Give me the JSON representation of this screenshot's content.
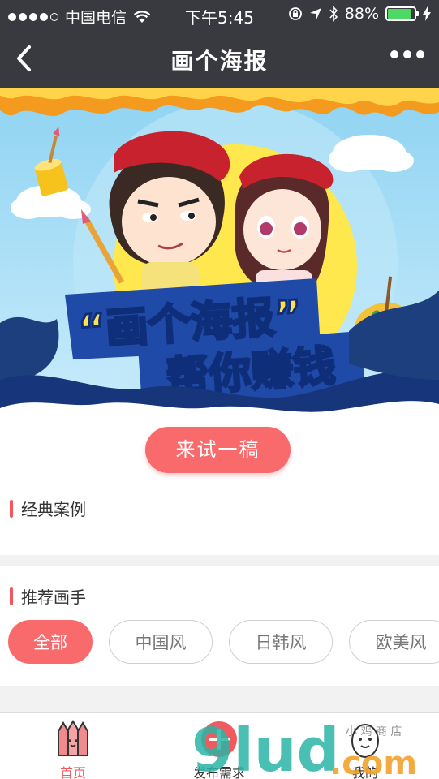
{
  "status_bar": {
    "carrier": "中国电信",
    "time": "下午5:45",
    "battery": "88%",
    "battery_level": 0.88
  },
  "nav": {
    "title": "画个海报"
  },
  "banner": {
    "headline_1": "“画个海报”",
    "headline_2": "帮你赚钱"
  },
  "cta": {
    "label": "来试一稿"
  },
  "sections": {
    "cases_title": "经典案例",
    "painters_title": "推荐画手"
  },
  "filters": [
    {
      "label": "全部",
      "active": true
    },
    {
      "label": "中国风",
      "active": false
    },
    {
      "label": "日韩风",
      "active": false
    },
    {
      "label": "欧美风",
      "active": false
    }
  ],
  "tabbar": {
    "items": [
      {
        "label": "首页",
        "icon": "home-pencils-icon",
        "active": true
      },
      {
        "label": "发布需求",
        "icon": "plus-icon",
        "active": false
      },
      {
        "label": "我的",
        "icon": "egg-icon",
        "active": false
      }
    ]
  },
  "watermark": {
    "text_main": "9lud",
    "text_suffix": ".com",
    "text_small": "小 鸡 商 店"
  },
  "colors": {
    "accent": "#f96a6d",
    "navbar": "#393a3f",
    "battery": "#4cd964"
  }
}
